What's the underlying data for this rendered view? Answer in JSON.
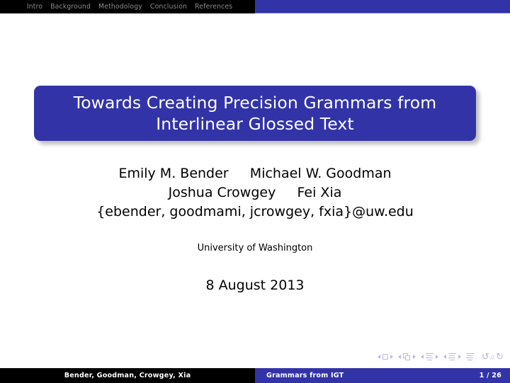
{
  "navbar": {
    "sections": [
      {
        "label": "Intro"
      },
      {
        "label": "Background"
      },
      {
        "label": "Methodology"
      },
      {
        "label": "Conclusion"
      },
      {
        "label": "References"
      }
    ],
    "active_color": "#8c8c8c",
    "left_bg": "#000000",
    "right_bg": "#3333a8"
  },
  "title": {
    "line1": "Towards Creating Precision Grammars from",
    "line2": "Interlinear Glossed Text",
    "box_color": "#3333a8",
    "text_color": "#ffffff"
  },
  "authors": {
    "line1": "Emily M. Bender     Michael W. Goodman",
    "line2": "Joshua Crowgey     Fei Xia",
    "emails": "{ebender, goodmami, jcrowgey, fxia}@uw.edu"
  },
  "institute": "University of Washington",
  "date": "8 August 2013",
  "navigation_symbols": {
    "slide_icon": "slide-navigation-icon",
    "frame_icon": "frame-navigation-icon",
    "subsection_icon": "subsection-navigation-icon",
    "section_icon": "section-navigation-icon",
    "presentation_icon": "presentation-navigation-icon",
    "back_arrow": "↺",
    "search_glyph": "⌕",
    "forward_arrow": "↻",
    "color": "#b9b9e0"
  },
  "footer": {
    "authors": "Bender, Goodman, Crowgey, Xia",
    "short_title": "Grammars from IGT",
    "page": "1 / 26",
    "left_bg": "#000000",
    "right_bg": "#3333a8"
  }
}
